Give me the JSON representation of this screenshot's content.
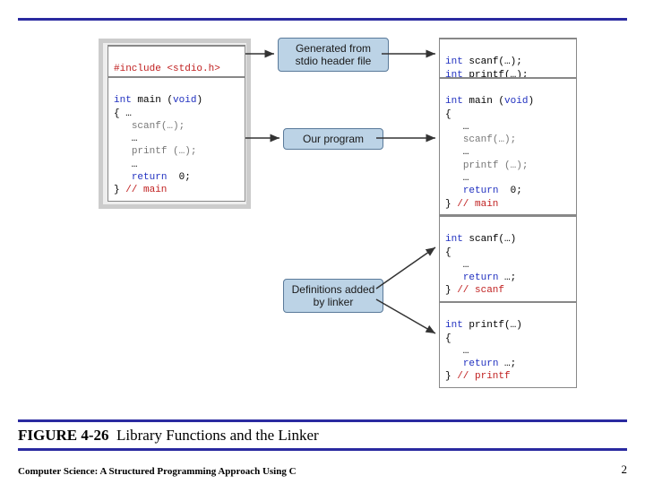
{
  "caption": {
    "number": "FIGURE 4-26",
    "title": "Library Functions and the Linker"
  },
  "footer": "Computer Science: A Structured Programming Approach Using C",
  "page_number": "2",
  "labels": {
    "generated": "Generated from\nstdio header file",
    "program": "Our program",
    "linker": "Definitions\nadded by linker"
  },
  "boxes": {
    "include": "#include <stdio.h>",
    "main_left": "int main (void)\n{ …\n   scanf(…);\n   …\n   printf (…);\n   …\n   return  0;\n} // main",
    "protos": "int scanf(…);\nint printf(…);",
    "main_right": "int main (void)\n{\n   …\n   scanf(…);\n   …\n   printf (…);\n   …\n   return  0;\n} // main",
    "scanf_def": "int scanf(…)\n{\n   …\n   return …;\n} // scanf",
    "printf_def": "int printf(…)\n{\n   …\n   return …;\n} // printf"
  },
  "chart_data": {
    "type": "diagram",
    "title": "Library Functions and the Linker",
    "nodes": [
      {
        "id": "include",
        "kind": "code",
        "text": "#include <stdio.h>"
      },
      {
        "id": "main_left",
        "kind": "code",
        "text": "int main (void)\n{ …\n   scanf(…);\n   …\n   printf (…);\n   …\n   return  0;\n} // main"
      },
      {
        "id": "generated",
        "kind": "label",
        "text": "Generated from stdio header file"
      },
      {
        "id": "program",
        "kind": "label",
        "text": "Our program"
      },
      {
        "id": "linker",
        "kind": "label",
        "text": "Definitions added by linker"
      },
      {
        "id": "protos",
        "kind": "code",
        "text": "int scanf(…);\nint printf(…);"
      },
      {
        "id": "main_right",
        "kind": "code",
        "text": "int main (void)\n{\n   …\n   scanf(…);\n   …\n   printf (…);\n   …\n   return  0;\n} // main"
      },
      {
        "id": "scanf_def",
        "kind": "code",
        "text": "int scanf(…)\n{\n   …\n   return …;\n} // scanf"
      },
      {
        "id": "printf_def",
        "kind": "code",
        "text": "int printf(…)\n{\n   …\n   return …;\n} // printf"
      }
    ],
    "edges": [
      {
        "from": "include",
        "to": "generated"
      },
      {
        "from": "generated",
        "to": "protos"
      },
      {
        "from": "main_left",
        "to": "program"
      },
      {
        "from": "program",
        "to": "main_right"
      },
      {
        "from": "linker",
        "to": "scanf_def"
      },
      {
        "from": "linker",
        "to": "printf_def"
      }
    ]
  }
}
